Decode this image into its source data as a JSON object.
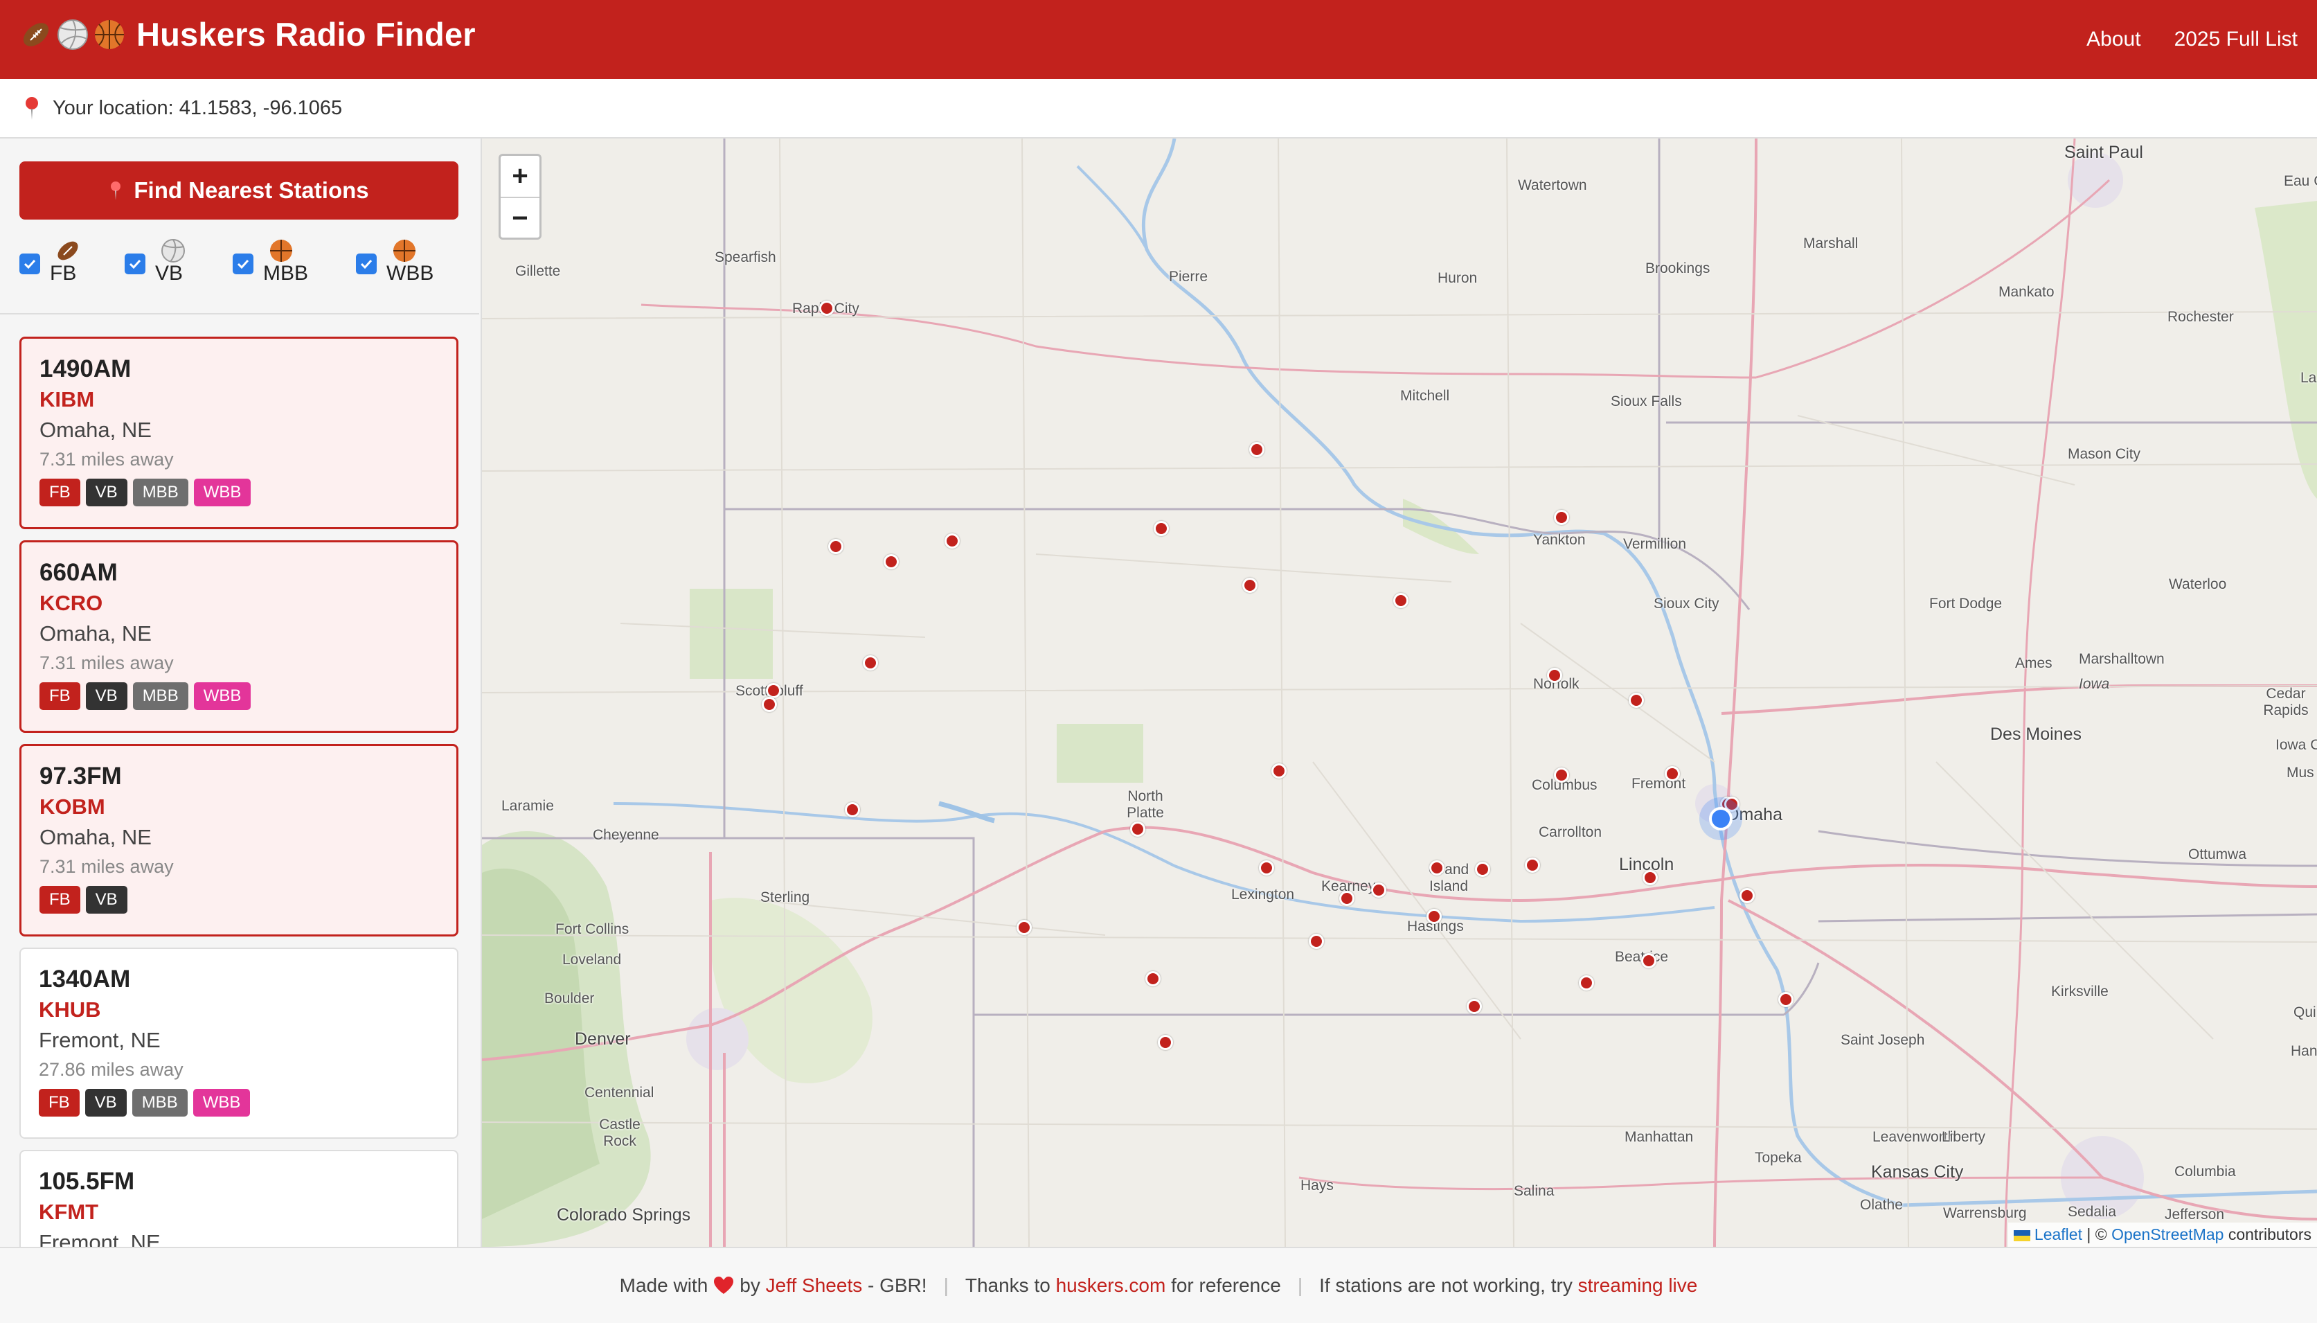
{
  "header": {
    "title": "Huskers Radio Finder",
    "nav": [
      "About",
      "2025 Full List"
    ]
  },
  "location": {
    "text": "Your location: 41.1583, -96.1065"
  },
  "sidebar": {
    "find_button": "Find Nearest Stations",
    "filters": [
      {
        "label": "FB",
        "checked": true,
        "icon": "football-icon"
      },
      {
        "label": "VB",
        "checked": true,
        "icon": "volleyball-icon"
      },
      {
        "label": "MBB",
        "checked": true,
        "icon": "basketball-icon"
      },
      {
        "label": "WBB",
        "checked": true,
        "icon": "basketball-icon"
      }
    ],
    "stations": [
      {
        "freq": "1490AM",
        "call": "KIBM",
        "city": "Omaha, NE",
        "dist": "7.31 miles away",
        "badges": [
          "FB",
          "VB",
          "MBB",
          "WBB"
        ]
      },
      {
        "freq": "660AM",
        "call": "KCRO",
        "city": "Omaha, NE",
        "dist": "7.31 miles away",
        "badges": [
          "FB",
          "VB",
          "MBB",
          "WBB"
        ]
      },
      {
        "freq": "97.3FM",
        "call": "KOBM",
        "city": "Omaha, NE",
        "dist": "7.31 miles away",
        "badges": [
          "FB",
          "VB"
        ]
      },
      {
        "freq": "1340AM",
        "call": "KHUB",
        "city": "Fremont, NE",
        "dist": "27.86 miles away",
        "badges": [
          "FB",
          "VB",
          "MBB",
          "WBB"
        ]
      },
      {
        "freq": "105.5FM",
        "call": "KFMT",
        "city": "Fremont, NE",
        "dist": "",
        "badges": []
      }
    ]
  },
  "map": {
    "zoom_in": "+",
    "zoom_out": "−",
    "attribution": {
      "leaflet": "Leaflet",
      "sep": "| ©",
      "osm": "OpenStreetMap",
      "suffix": "contributors"
    },
    "labels": [
      "Saint Paul",
      "Eau Cla",
      "Watertown",
      "Marshall",
      "Gillette",
      "Spearfish",
      "Pierre",
      "Huron",
      "Brookings",
      "Mankato",
      "Rochester",
      "Rapid City",
      "Mitchell",
      "Sioux Falls",
      "Mason City",
      "Yankton",
      "Vermillion",
      "Sioux City",
      "Fort Dodge",
      "Waterloo",
      "Scottsbluff",
      "Norfolk",
      "Ames",
      "Marshalltown",
      "Iowa",
      "Cedar Rapids",
      "Des Moines",
      "Iowa C",
      "Laramie",
      "Cheyenne",
      "North Platte",
      "Columbus",
      "Fremont",
      "Omaha",
      "Carrollton",
      "Ottumwa",
      "Lincoln",
      "Grand Island",
      "Kearney",
      "Lexington",
      "Hastings",
      "Sterling",
      "Fort Collins",
      "Loveland",
      "Boulder",
      "Denver",
      "Centennial",
      "Castle Rock",
      "Beatrice",
      "Kirksville",
      "Saint Joseph",
      "Manhattan",
      "Topeka",
      "Leavenworth",
      "Liberty",
      "Kansas City",
      "Hays",
      "Salina",
      "Colorado Springs",
      "Olathe",
      "Warrensburg",
      "Sedalia",
      "Jefferson",
      "Columbia",
      "Mus",
      "Qui",
      "Han",
      "La"
    ]
  },
  "footer": {
    "made_with": "Made with",
    "by": "by",
    "author": "Jeff Sheets",
    "gbr": "- GBR!",
    "thanks": "Thanks to",
    "site": "huskers.com",
    "ref": "for reference",
    "notworking": "If stations are not working, try",
    "streaming": "streaming live"
  },
  "colors": {
    "brand": "#c2221d",
    "fb": "#c2221d",
    "vb": "#333333",
    "mbb": "#6e6e6e",
    "wbb": "#e3359a",
    "checkbox": "#2b7de9"
  }
}
